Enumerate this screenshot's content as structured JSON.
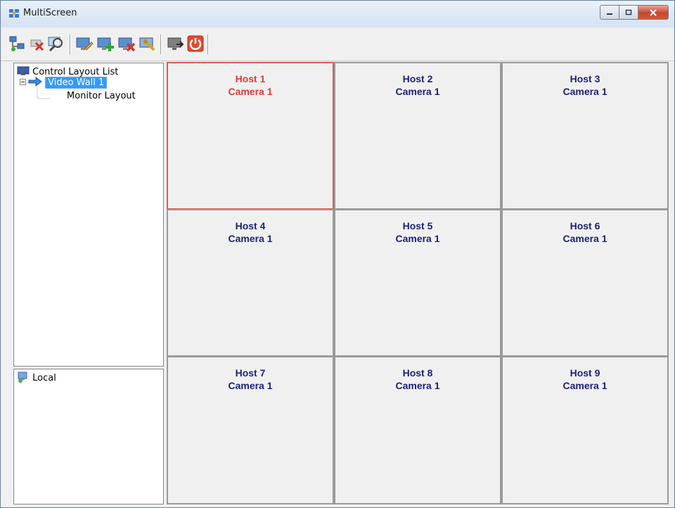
{
  "window": {
    "title": "MultiScreen"
  },
  "colors": {
    "titlebar_top": "#e9f1fb",
    "titlebar_bottom": "#d4e2f3",
    "active_cell_border": "#e05a5a",
    "active_text": "#e53935",
    "cell_text": "#1b1f7a",
    "selection": "#3399ff"
  },
  "toolbar": {
    "buttons": [
      {
        "icon": "network-tree-icon"
      },
      {
        "icon": "disconnect-icon"
      },
      {
        "icon": "search-monitor-icon"
      },
      {
        "icon": "edit-monitor-icon"
      },
      {
        "icon": "add-monitor-icon"
      },
      {
        "icon": "delete-monitor-icon"
      },
      {
        "icon": "monitor-settings-icon"
      },
      {
        "icon": "monitor-export-icon"
      },
      {
        "icon": "power-icon"
      }
    ]
  },
  "layout_tree": {
    "root": "Control Layout List",
    "wall": "Video Wall 1",
    "child": "Monitor Layout"
  },
  "host_tree": {
    "root": "Local"
  },
  "grid": {
    "active_index": 0,
    "cells": [
      {
        "host": "Host 1",
        "camera": "Camera 1"
      },
      {
        "host": "Host 2",
        "camera": "Camera 1"
      },
      {
        "host": "Host 3",
        "camera": "Camera 1"
      },
      {
        "host": "Host 4",
        "camera": "Camera 1"
      },
      {
        "host": "Host 5",
        "camera": "Camera 1"
      },
      {
        "host": "Host 6",
        "camera": "Camera 1"
      },
      {
        "host": "Host 7",
        "camera": "Camera 1"
      },
      {
        "host": "Host 8",
        "camera": "Camera 1"
      },
      {
        "host": "Host 9",
        "camera": "Camera 1"
      }
    ]
  }
}
